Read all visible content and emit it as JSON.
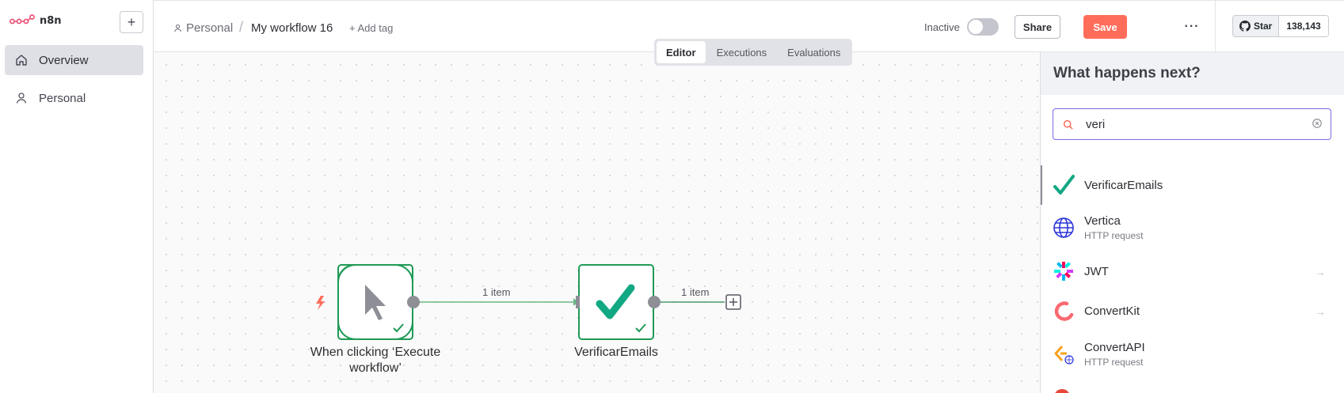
{
  "brand": {
    "name": "n8n"
  },
  "sidebar": {
    "new_label": "+",
    "items": [
      {
        "label": "Overview",
        "icon": "home-icon",
        "active": true
      },
      {
        "label": "Personal",
        "icon": "user-icon",
        "active": false
      }
    ]
  },
  "header": {
    "owner": "Personal",
    "separator": "/",
    "workflow_name": "My workflow 16",
    "add_tag": "+ Add tag",
    "status_label": "Inactive",
    "active": false,
    "share_label": "Share",
    "save_label": "Save",
    "more_label": "···",
    "github": {
      "star_label": "Star",
      "count": "138,143"
    }
  },
  "view_tabs": [
    {
      "label": "Editor",
      "active": true
    },
    {
      "label": "Executions",
      "active": false
    },
    {
      "label": "Evaluations",
      "active": false
    }
  ],
  "workflow": {
    "nodes": [
      {
        "name": "When clicking ‘Execute workflow’",
        "line1": "When clicking ‘Execute",
        "line2": "workflow’",
        "icon": "cursor-pointer-icon",
        "trigger": true,
        "executed": true
      },
      {
        "name": "VerificarEmails",
        "icon": "checkmark-icon",
        "trigger": false,
        "executed": true
      }
    ],
    "connections": [
      {
        "label": "1 item"
      },
      {
        "label": "1 item"
      }
    ]
  },
  "panel": {
    "title": "What happens next?",
    "search": {
      "value": "veri"
    },
    "results": [
      {
        "name": "VerificarEmails",
        "subtitle": "",
        "icon": "checkmark-icon",
        "has_arrow": false,
        "selected": true
      },
      {
        "name": "Vertica",
        "subtitle": "HTTP request",
        "icon": "globe-icon",
        "has_arrow": false,
        "selected": false
      },
      {
        "name": "JWT",
        "subtitle": "",
        "icon": "jwt-icon",
        "has_arrow": true,
        "selected": false
      },
      {
        "name": "ConvertKit",
        "subtitle": "",
        "icon": "convertkit-icon",
        "has_arrow": true,
        "selected": false
      },
      {
        "name": "ConvertAPI",
        "subtitle": "HTTP request",
        "icon": "convertapi-icon",
        "has_arrow": false,
        "selected": false
      }
    ]
  },
  "colors": {
    "accent": "#ff6d5a",
    "success": "#0f9b5b",
    "node_border": "#1e9a55",
    "search_focus": "#7c6be0",
    "verify_check": "#13a884"
  }
}
